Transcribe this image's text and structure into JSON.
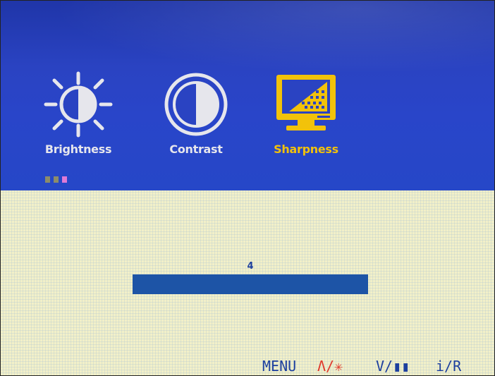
{
  "menu": {
    "items": [
      {
        "label": "Brightness",
        "icon": "brightness-icon"
      },
      {
        "label": "Contrast",
        "icon": "contrast-icon"
      },
      {
        "label": "Sharpness",
        "icon": "sharpness-icon",
        "selected": true
      }
    ],
    "page_indicator": {
      "count": 3,
      "active_index": 2
    }
  },
  "sharpness": {
    "value": "4"
  },
  "footer": {
    "menu": "MENU",
    "up": "Λ/✳",
    "down": "V/▮▮",
    "input": "i/R"
  },
  "colors": {
    "header_bg": "#2a43c2",
    "content_bg": "#f2f0c8",
    "selected_label": "#f2c20a",
    "unselected_label": "#e6e6ec",
    "slider_bar": "#1d54a6",
    "footer_text": "#1c3f9e",
    "footer_accent": "#e0382b"
  }
}
